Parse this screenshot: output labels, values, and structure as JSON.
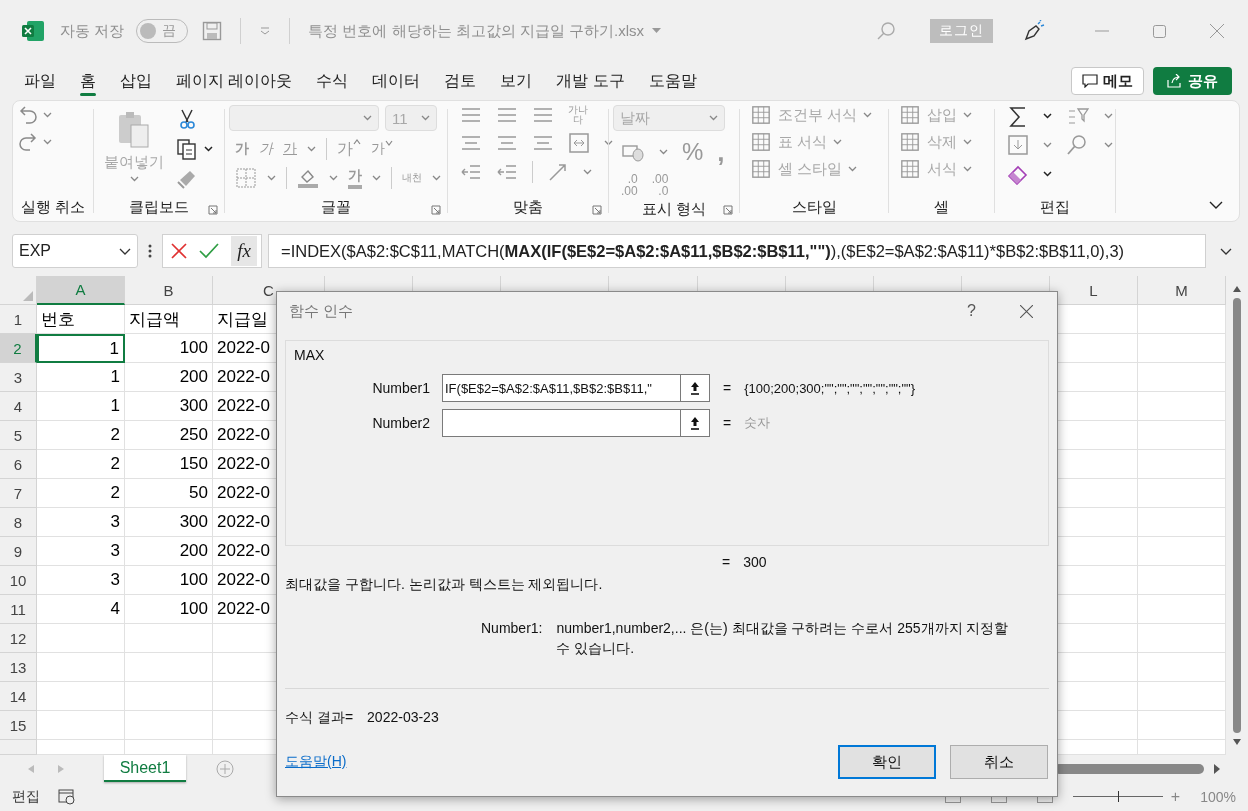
{
  "title_bar": {
    "autosave_label": "자동 저장",
    "autosave": {
      "on": false,
      "label": "끔"
    },
    "filename": "특정 번호에 해당하는 최고값의 지급일 구하기.xlsx",
    "login": "로그인"
  },
  "menu_tabs": [
    {
      "label": "파일",
      "selected": false
    },
    {
      "label": "홈",
      "selected": true
    },
    {
      "label": "삽입",
      "selected": false
    },
    {
      "label": "페이지 레이아웃",
      "selected": false
    },
    {
      "label": "수식",
      "selected": false
    },
    {
      "label": "데이터",
      "selected": false
    },
    {
      "label": "검토",
      "selected": false
    },
    {
      "label": "보기",
      "selected": false
    },
    {
      "label": "개발 도구",
      "selected": false
    },
    {
      "label": "도움말",
      "selected": false
    }
  ],
  "memo_button": "메모",
  "share_button": "공유",
  "ribbon": {
    "undo": {
      "label": "실행 취소"
    },
    "clipboard": {
      "label": "클립보드",
      "paste": "붙여넣기"
    },
    "font": {
      "label": "글꼴",
      "size": "11",
      "bold": "가",
      "font_color": "가",
      "italic": "가",
      "underline": "가",
      "grow": "가",
      "shrink": "가",
      "phonetic": "내천"
    },
    "alignment": {
      "label": "맞춤",
      "wrap": [
        "가나",
        "다"
      ]
    },
    "number": {
      "label": "표시 형식",
      "format": "날짜",
      "percent": "%",
      "comma": ",",
      "decimals": [
        {
          "top": ".0",
          "bottom": ".00"
        },
        {
          "top": ".00",
          "bottom": ".0"
        }
      ]
    },
    "styles": {
      "label": "스타일",
      "items": [
        {
          "label": "조건부 서식",
          "disabled": true
        },
        {
          "label": "표 서식",
          "disabled": true
        },
        {
          "label": "셀 스타일",
          "disabled": true
        }
      ]
    },
    "cells": {
      "label": "셀",
      "items": [
        {
          "label": "삽입",
          "disabled": true
        },
        {
          "label": "삭제",
          "disabled": true
        },
        {
          "label": "서식",
          "disabled": true
        }
      ]
    },
    "editing": {
      "label": "편집"
    }
  },
  "formula_bar": {
    "name_box": "EXP",
    "insert_function": "fx",
    "formula": "=INDEX($A$2:$C$11,MATCH(**MAX(IF($E$2=$A$2:$A$11,$B$2:$B$11,\"\")**),($E$2=$A$2:$A$11)*$B$2:$B$11,0),3)"
  },
  "sheet": {
    "columns": [
      {
        "label": "A",
        "selected": true
      },
      {
        "label": "B",
        "selected": false
      },
      {
        "label": "C",
        "selected": false
      },
      {
        "selected": false
      },
      {
        "selected": false
      },
      {
        "selected": false
      },
      {
        "selected": false
      },
      {
        "selected": false
      },
      {
        "selected": false
      },
      {
        "selected": false
      },
      {
        "selected": false
      },
      {
        "label": "L",
        "selected": false
      },
      {
        "label": "M",
        "selected": false
      }
    ],
    "rows": [
      {
        "num": "1",
        "selected": false,
        "kind": "text",
        "cells": [
          "번호",
          "지급액",
          "지급일"
        ]
      },
      {
        "num": "2",
        "selected": true,
        "kind": "number",
        "cells": [
          "1",
          "100",
          "2022-0"
        ]
      },
      {
        "num": "3",
        "selected": false,
        "kind": "number",
        "cells": [
          "1",
          "200",
          "2022-0"
        ]
      },
      {
        "num": "4",
        "selected": false,
        "kind": "number",
        "cells": [
          "1",
          "300",
          "2022-0"
        ]
      },
      {
        "num": "5",
        "selected": false,
        "kind": "number",
        "cells": [
          "2",
          "250",
          "2022-0"
        ]
      },
      {
        "num": "6",
        "selected": false,
        "kind": "number",
        "cells": [
          "2",
          "150",
          "2022-0"
        ]
      },
      {
        "num": "7",
        "selected": false,
        "kind": "number",
        "cells": [
          "2",
          "50",
          "2022-0"
        ]
      },
      {
        "num": "8",
        "selected": false,
        "kind": "number",
        "cells": [
          "3",
          "300",
          "2022-0"
        ]
      },
      {
        "num": "9",
        "selected": false,
        "kind": "number",
        "cells": [
          "3",
          "200",
          "2022-0"
        ]
      },
      {
        "num": "10",
        "selected": false,
        "kind": "number",
        "cells": [
          "3",
          "100",
          "2022-0"
        ]
      },
      {
        "num": "11",
        "selected": false,
        "kind": "number",
        "cells": [
          "4",
          "100",
          "2022-0"
        ]
      },
      {
        "num": "12",
        "selected": false,
        "kind": "number",
        "cells": []
      },
      {
        "num": "13",
        "selected": false,
        "kind": "number",
        "cells": []
      },
      {
        "num": "14",
        "selected": false,
        "kind": "number",
        "cells": []
      },
      {
        "num": "15",
        "selected": false,
        "kind": "number",
        "cells": []
      }
    ]
  },
  "sheet_tabs": [
    {
      "label": "Sheet1",
      "selected": true
    }
  ],
  "status_bar": {
    "mode": "편집",
    "zoom_in": "+",
    "zoom": {
      "level": 0.5,
      "label": "100%"
    }
  },
  "dialog": {
    "title": "함수 인수",
    "help_icon": "?",
    "function": "MAX",
    "arguments": [
      {
        "label": "Number1",
        "value": "IF($E$2=$A$2:$A$11,$B$2:$B$11,\"",
        "equals": "=",
        "result": "{100;200;300;\"\";\"\";\"\";\"\";\"\";\"\";\"\"}",
        "dimmed": false
      },
      {
        "label": "Number2",
        "equals": "=",
        "result": "숫자",
        "dimmed": true
      }
    ],
    "result_equals": "=",
    "result": "300",
    "description": "최대값을 구합니다. 논리값과 텍스트는 제외됩니다.",
    "arg_label": "Number1:",
    "arg_help": "number1,number2,... 은(는) 최대값을 구하려는 수로서 255개까지 지정할 수 있습니다.",
    "formula_result_label": "수식 결과=",
    "formula_result": "2022-03-23",
    "help_link": "도움말(H)",
    "buttons": [
      {
        "label": "확인",
        "selected": true
      },
      {
        "label": "취소",
        "selected": false
      }
    ]
  }
}
